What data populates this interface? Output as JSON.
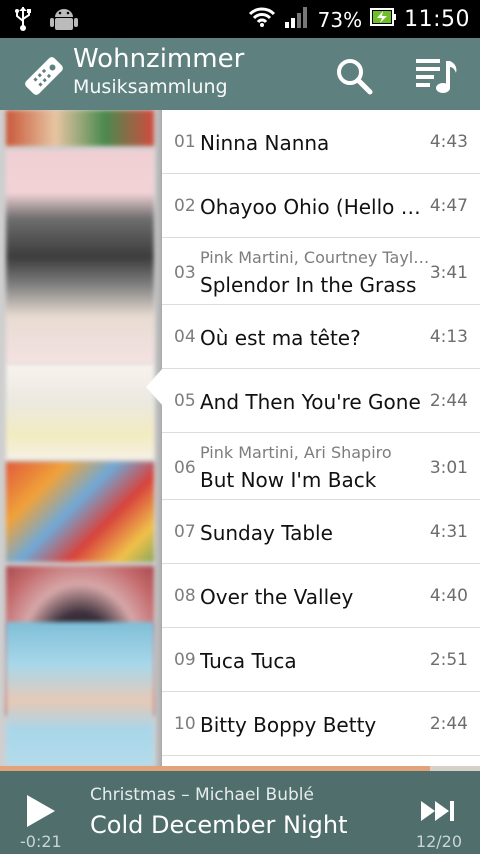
{
  "status_bar": {
    "battery": "73%",
    "time": "11:50"
  },
  "header": {
    "title": "Wohnzimmer",
    "subtitle": "Musiksammlung"
  },
  "tracks": [
    {
      "num": "01",
      "title": "Ninna Nanna",
      "artist": "",
      "duration": "4:43"
    },
    {
      "num": "02",
      "title": "Ohayoo Ohio (Hello Oh…",
      "artist": "",
      "duration": "4:47"
    },
    {
      "num": "03",
      "title": "Splendor In the Grass",
      "artist": "Pink Martini, Courtney Tayl…",
      "duration": "3:41"
    },
    {
      "num": "04",
      "title": "Où est ma tête?",
      "artist": "",
      "duration": "4:13"
    },
    {
      "num": "05",
      "title": "And Then You're Gone",
      "artist": "",
      "duration": "2:44"
    },
    {
      "num": "06",
      "title": "But Now I'm Back",
      "artist": "Pink Martini, Ari Shapiro",
      "duration": "3:01"
    },
    {
      "num": "07",
      "title": "Sunday Table",
      "artist": "",
      "duration": "4:31"
    },
    {
      "num": "08",
      "title": "Over the Valley",
      "artist": "",
      "duration": "4:40"
    },
    {
      "num": "09",
      "title": "Tuca Tuca",
      "artist": "",
      "duration": "2:51"
    },
    {
      "num": "10",
      "title": "Bitty Boppy Betty",
      "artist": "",
      "duration": "2:44"
    }
  ],
  "player": {
    "subtitle": "Christmas – Michael Bublé",
    "title": "Cold December Night",
    "elapsed": "-0:21",
    "position": "12/20",
    "progress_fraction": 0.895
  },
  "colors": {
    "action_bar": "#5e807e",
    "player_bar": "#4f6e6c",
    "progress_fill": "#e2a27a",
    "status_bar": "#000000"
  },
  "icons": [
    "usb-icon",
    "android-debug-icon",
    "wifi-icon",
    "signal-icon",
    "battery-charging-icon",
    "remote-control-icon",
    "search-icon",
    "queue-music-icon",
    "play-icon",
    "skip-next-icon"
  ]
}
